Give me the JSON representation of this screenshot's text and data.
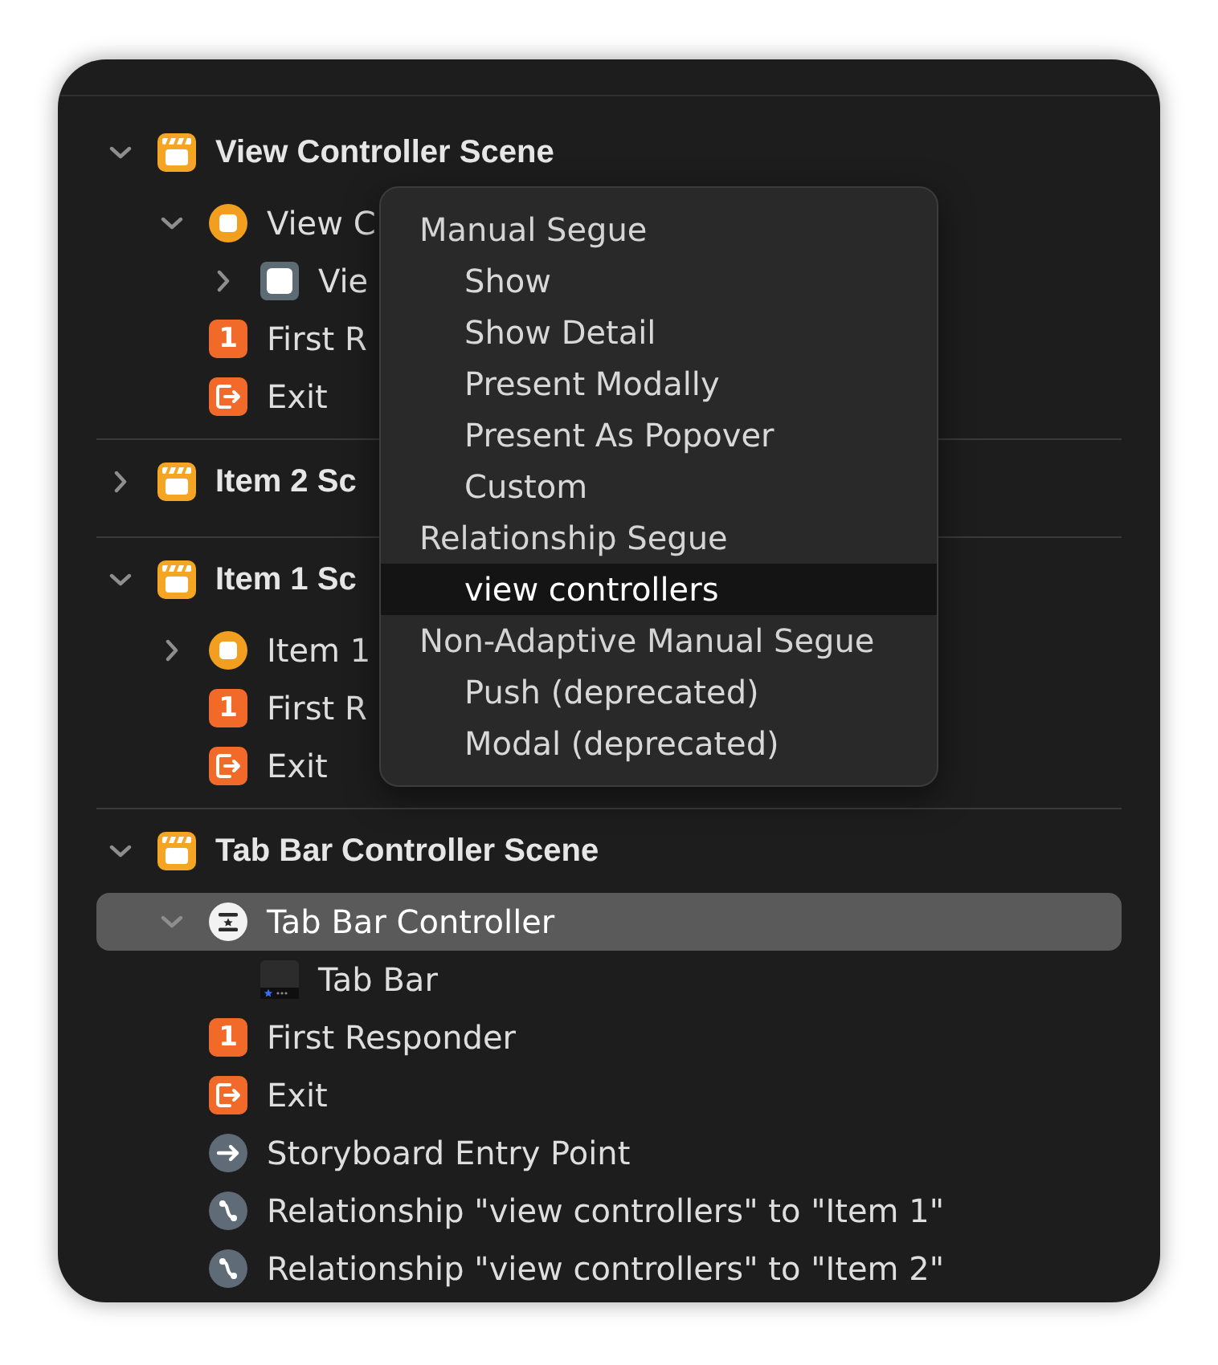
{
  "scenes": [
    {
      "label": "View Controller Scene",
      "kind": "scene",
      "expanded": true,
      "selected": false,
      "children": [
        {
          "label": "View C",
          "kind": "view_controller",
          "expanded": true,
          "selected": false,
          "children": [
            {
              "label": "Vie",
              "kind": "view",
              "expanded": false,
              "selected": false
            }
          ]
        },
        {
          "label": "First R",
          "kind": "first_responder",
          "icon_text": "1",
          "selected": false
        },
        {
          "label": "Exit",
          "kind": "exit",
          "selected": false
        }
      ]
    },
    {
      "label": "Item 2 Sc",
      "kind": "scene",
      "expanded": false,
      "selected": false
    },
    {
      "label": "Item 1 Sc",
      "kind": "scene",
      "expanded": true,
      "selected": false,
      "children": [
        {
          "label": "Item 1",
          "kind": "view_controller",
          "expanded": false,
          "selected": false
        },
        {
          "label": "First R",
          "kind": "first_responder",
          "icon_text": "1",
          "selected": false
        },
        {
          "label": "Exit",
          "kind": "exit",
          "selected": false
        }
      ]
    },
    {
      "label": "Tab Bar Controller Scene",
      "kind": "scene",
      "expanded": true,
      "selected": false,
      "children": [
        {
          "label": "Tab Bar Controller",
          "kind": "tab_bar_controller",
          "expanded": true,
          "selected": true,
          "children": [
            {
              "label": "Tab Bar",
              "kind": "tab_bar",
              "selected": false
            }
          ]
        },
        {
          "label": "First Responder",
          "kind": "first_responder",
          "icon_text": "1",
          "selected": false
        },
        {
          "label": "Exit",
          "kind": "exit",
          "selected": false
        },
        {
          "label": "Storyboard Entry Point",
          "kind": "entry_point",
          "selected": false
        },
        {
          "label": "Relationship \"view controllers\" to \"Item 1\"",
          "kind": "relationship",
          "selected": false
        },
        {
          "label": "Relationship \"view controllers\" to \"Item 2\"",
          "kind": "relationship",
          "selected": false
        }
      ]
    }
  ],
  "segue_menu": {
    "sections": [
      {
        "title": "Manual Segue",
        "items": [
          {
            "label": "Show",
            "selected": false
          },
          {
            "label": "Show Detail",
            "selected": false
          },
          {
            "label": "Present Modally",
            "selected": false
          },
          {
            "label": "Present As Popover",
            "selected": false
          },
          {
            "label": "Custom",
            "selected": false
          }
        ]
      },
      {
        "title": "Relationship Segue",
        "items": [
          {
            "label": "view controllers",
            "selected": true
          }
        ]
      },
      {
        "title": "Non-Adaptive Manual Segue",
        "items": [
          {
            "label": "Push (deprecated)",
            "selected": false
          },
          {
            "label": "Modal (deprecated)",
            "selected": false
          }
        ]
      }
    ]
  }
}
